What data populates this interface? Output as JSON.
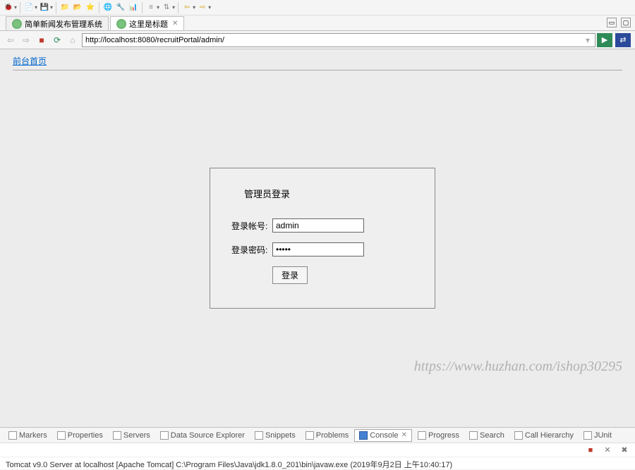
{
  "tabs": [
    {
      "label": "简单新闻发布管理系统",
      "active": false
    },
    {
      "label": "这里是标题",
      "active": true
    }
  ],
  "url": "http://localhost:8080/recruitPortal/admin/",
  "page": {
    "front_link": "前台首页",
    "login": {
      "title": "管理员登录",
      "username_label": "登录帐号:",
      "username_value": "admin",
      "password_label": "登录密码:",
      "password_value": "•••••",
      "submit_label": "登录"
    }
  },
  "watermark": "https://www.huzhan.com/ishop30295",
  "bottom_tabs": [
    "Markers",
    "Properties",
    "Servers",
    "Data Source Explorer",
    "Snippets",
    "Problems",
    "Console",
    "Progress",
    "Search",
    "Call Hierarchy",
    "JUnit"
  ],
  "status": "Tomcat v9.0 Server at localhost [Apache Tomcat] C:\\Program Files\\Java\\jdk1.8.0_201\\bin\\javaw.exe (2019年9月2日 上午10:40:17)"
}
